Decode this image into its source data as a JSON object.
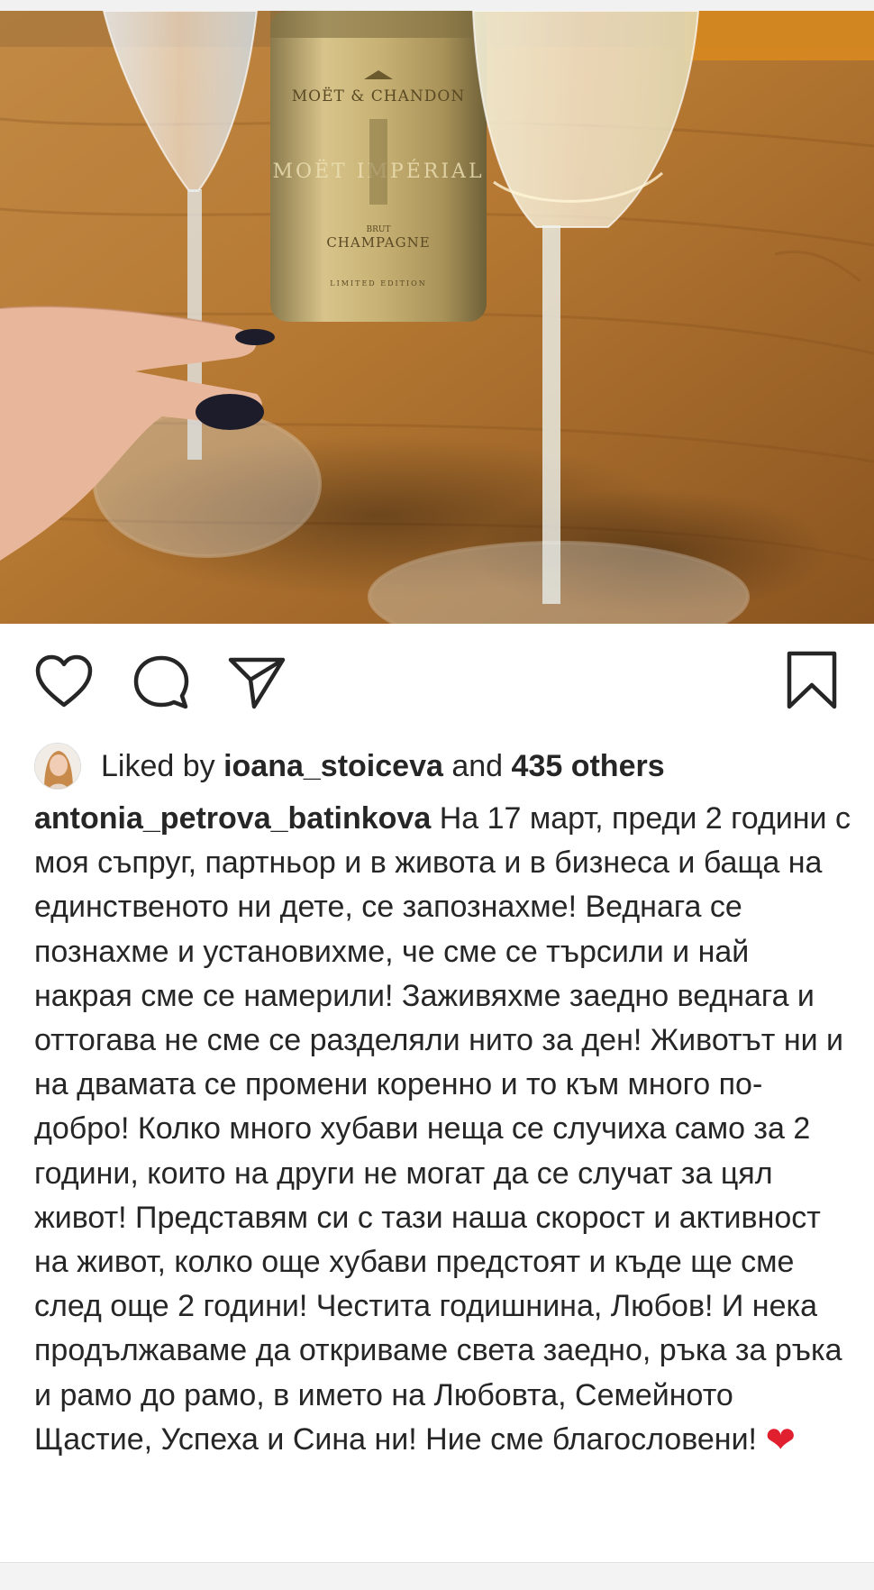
{
  "post": {
    "liked_by": {
      "prefix": "Liked by",
      "user": "ioana_stoiceva",
      "conjunction": "and",
      "others": "435 others"
    },
    "author": "antonia_petrova_batinkova",
    "caption": "На 17 март, преди 2 години с моя съпруг, партньор и в живота и в бизнеса и баща на единственото ни дете, се запознахме! Веднага се познахме и установихме, че сме се търсили и най накрая сме се намерили! Заживяхме заедно веднага и оттогава не сме се разделяли нито за ден! Животът ни и на двамата се промени коренно и то към много по-добро! Колко много хубави неща се случиха само за 2 години, които на други не могат да се случат за цял живот! Представям си с тази наша скорост и активност на живот, колко още хубави предстоят и къде ще сме след още 2 години! Честита годишнина, Любов! И нека продължаваме да откриваме света заедно, ръка за ръка и рамо до рамо, в името на Любовта, Семейното Щастие, Успеха и Сина ни! Ние сме благословени!",
    "caption_emoji": "❤"
  },
  "photo": {
    "bottle_text": {
      "brand": "MOËT & CHANDON",
      "line": "MOËT IMPÉRIAL",
      "brut": "BRUT",
      "type": "CHAMPAGNE",
      "edition": "LIMITED EDITION"
    }
  },
  "icons": {
    "like": "heart-outline-icon",
    "comment": "speech-bubble-icon",
    "share": "paper-plane-icon",
    "save": "bookmark-icon"
  },
  "colors": {
    "text": "#262626",
    "emoji_heart": "#e0202e",
    "icon_stroke": "#262626"
  }
}
